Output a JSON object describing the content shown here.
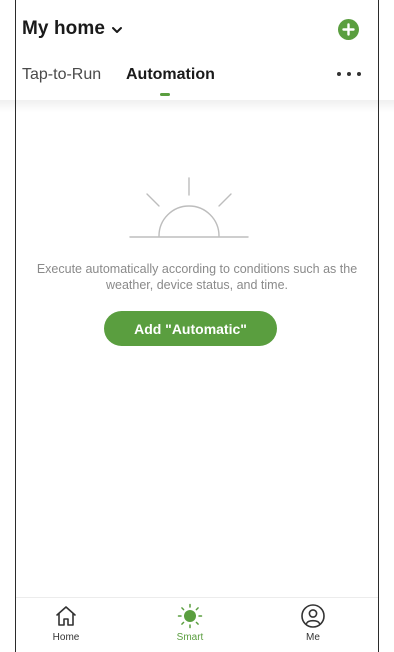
{
  "header": {
    "home_title": "My home",
    "icons": {
      "chevron": "chevron-down-icon",
      "add": "plus-circle-icon"
    }
  },
  "tabs": {
    "items": [
      {
        "label": "Tap-to-Run",
        "active": false
      },
      {
        "label": "Automation",
        "active": true
      }
    ],
    "more_icon": "more-horizontal-icon"
  },
  "empty_state": {
    "illustration_icon": "sunrise-icon",
    "message": "Execute automatically according to conditions such as the weather, device status, and time.",
    "action_label": "Add \"Automatic\""
  },
  "bottom_nav": {
    "items": [
      {
        "label": "Home",
        "icon": "home-icon",
        "active": false
      },
      {
        "label": "Smart",
        "icon": "sun-icon",
        "active": true
      },
      {
        "label": "Me",
        "icon": "user-icon",
        "active": false
      }
    ]
  },
  "colors": {
    "accent": "#5a9e3f",
    "text_primary": "#1a1a1a",
    "text_muted": "#8a8a8a"
  }
}
